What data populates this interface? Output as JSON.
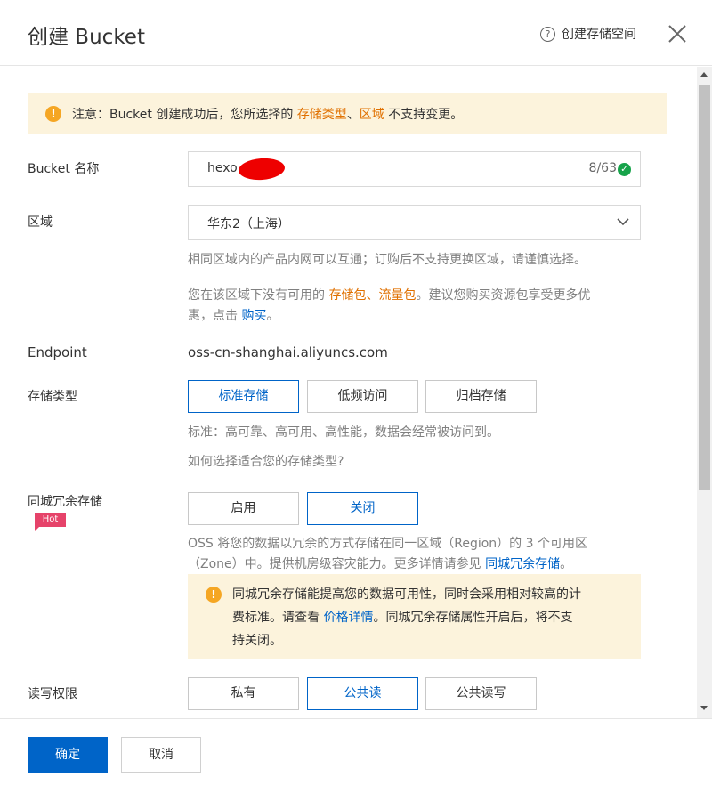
{
  "header": {
    "title": "创建 Bucket",
    "help_link": "创建存储空间",
    "help_icon": "question-circle-icon",
    "close_icon": "close-icon"
  },
  "notice": {
    "prefix": "注意：Bucket 创建成功后，您所选择的 ",
    "link1": "存储类型",
    "sep": "、",
    "link2": "区域",
    "suffix": " 不支持变更。",
    "icon": "warning-icon"
  },
  "bucket_name": {
    "label": "Bucket 名称",
    "value": "hexo",
    "counter": "8/63",
    "valid_icon": "check-circle-icon"
  },
  "region": {
    "label": "区域",
    "value": "华东2（上海）",
    "help1": "相同区域内的产品内网可以互通；订购后不支持更换区域，请谨慎选择。",
    "help2_prefix": "您在该区域下没有可用的 ",
    "help2_link": "存储包、流量包",
    "help2_mid_line1": "。建议您购买资源包享受更多优",
    "help2_mid_line2": "惠，点击 ",
    "help2_buy": "购买",
    "help2_end": "。"
  },
  "endpoint": {
    "label": "Endpoint",
    "value": "oss-cn-shanghai.aliyuncs.com"
  },
  "storage_class": {
    "label": "存储类型",
    "options": [
      "标准存储",
      "低频访问",
      "归档存储"
    ],
    "selected": "标准存储",
    "description": "标准：高可靠、高可用、高性能，数据会经常被访问到。",
    "guide_link": "如何选择适合您的存储类型?"
  },
  "zrs": {
    "label": "同城冗余存储",
    "badge": "Hot",
    "options": [
      "启用",
      "关闭"
    ],
    "selected": "关闭",
    "desc_line1": "OSS 将您的数据以冗余的方式存储在同一区域（Region）的 3 个可用区",
    "desc_line2_prefix": "（Zone）中。提供机房级容灾能力。更多详情请参见 ",
    "desc_link": "同城冗余存储",
    "desc_end": "。",
    "warn_line1": "同城冗余存储能提高您的数据可用性，同时会采用相对较高的计",
    "warn_line2_prefix": "费标准。请查看 ",
    "warn_link": "价格详情",
    "warn_line2_suffix": "。同城冗余存储属性开启后，将不支",
    "warn_line3": "持关闭。"
  },
  "acl": {
    "label": "读写权限",
    "options": [
      "私有",
      "公共读",
      "公共读写"
    ],
    "selected": "公共读"
  },
  "footer": {
    "ok": "确定",
    "cancel": "取消"
  },
  "colors": {
    "primary": "#0064c8",
    "notice_bg": "#fcf3dc",
    "warning": "#f5a623",
    "hot": "#e6436a",
    "link_orange": "#e07000"
  }
}
